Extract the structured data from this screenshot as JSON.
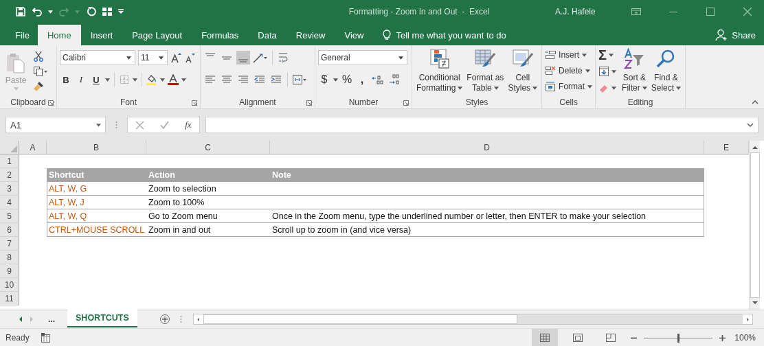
{
  "window": {
    "title": "Formatting - Zoom In and Out  -  Excel",
    "user": "A.J. Hafele"
  },
  "menu_tabs": [
    {
      "label": "File",
      "selected": false
    },
    {
      "label": "Home",
      "selected": true
    },
    {
      "label": "Insert",
      "selected": false
    },
    {
      "label": "Page Layout",
      "selected": false
    },
    {
      "label": "Formulas",
      "selected": false
    },
    {
      "label": "Data",
      "selected": false
    },
    {
      "label": "Review",
      "selected": false
    },
    {
      "label": "View",
      "selected": false
    }
  ],
  "tell_me": "Tell me what you want to do",
  "share": "Share",
  "ribbon": {
    "clipboard": {
      "label": "Clipboard",
      "paste": "Paste"
    },
    "font": {
      "label": "Font",
      "family": "Calibri",
      "size": "11",
      "bold": "B",
      "italic": "I",
      "underline": "U"
    },
    "alignment": {
      "label": "Alignment"
    },
    "number": {
      "label": "Number",
      "format": "General",
      "currency": "$",
      "percent": "%",
      "comma": ","
    },
    "styles": {
      "label": "Styles",
      "buttons": [
        {
          "line1": "Conditional",
          "line2": "Formatting"
        },
        {
          "line1": "Format as",
          "line2": "Table"
        },
        {
          "line1": "Cell",
          "line2": "Styles"
        }
      ]
    },
    "cells": {
      "label": "Cells",
      "buttons": [
        "Insert",
        "Delete",
        "Format"
      ]
    },
    "editing": {
      "label": "Editing",
      "sum": "Σ",
      "buttons": [
        {
          "line1": "Sort &",
          "line2": "Filter"
        },
        {
          "line1": "Find &",
          "line2": "Select"
        }
      ]
    }
  },
  "formula_bar": {
    "name_box": "A1",
    "function_label": "fx"
  },
  "sheet": {
    "columns": [
      "A",
      "B",
      "C",
      "D",
      "E"
    ],
    "rows": [
      "1",
      "2",
      "3",
      "4",
      "5",
      "6",
      "7",
      "8",
      "9",
      "10",
      "11"
    ],
    "table": {
      "header": [
        "Shortcut",
        "Action",
        "Note"
      ],
      "rows": [
        {
          "shortcut": "ALT, W, G",
          "action": "Zoom to selection"
        },
        {
          "shortcut": "ALT, W, J",
          "action": "Zoom to 100%"
        },
        {
          "shortcut": "ALT, W, Q",
          "action": "Go to Zoom menu",
          "note": "Once in the Zoom menu, type the underlined number or letter, then ENTER to make your selection"
        },
        {
          "shortcut": "CTRL+MOUSE SCROLL",
          "action": "Zoom in and out",
          "note": "Scroll up to zoom in (and vice versa)"
        }
      ]
    }
  },
  "sheet_tabs": {
    "more": "...",
    "tabs": [
      {
        "label": "SHORTCUTS",
        "selected": true
      }
    ]
  },
  "status_bar": {
    "status": "Ready",
    "views": [
      {
        "kind": "normal",
        "selected": true
      },
      {
        "kind": "page-layout",
        "selected": false
      },
      {
        "kind": "page-break",
        "selected": false
      }
    ],
    "zoom": {
      "level": 0.5,
      "reading": "100%"
    }
  }
}
